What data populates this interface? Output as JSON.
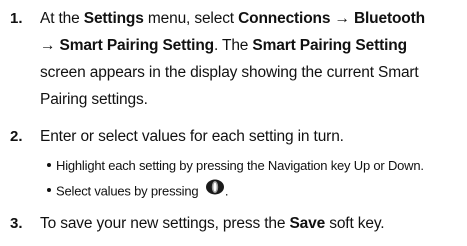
{
  "steps": [
    {
      "number": "1.",
      "parts": {
        "p1": "At the ",
        "b1": "Settings",
        "p2": " menu, select ",
        "b2": "Connections → Bluetooth",
        "b3": "→ Smart Pairing Setting",
        "p3": ". The ",
        "b4": "Smart Pairing Setting",
        "p4": "screen appears in the display showing the current Smart",
        "p5": "Pairing settings."
      }
    },
    {
      "number": "2.",
      "text": "Enter or select values for each setting in turn.",
      "bullets": [
        {
          "text": "Highlight each setting by pressing the Navigation key Up or Down."
        },
        {
          "text": "Select values by pressing",
          "icon": "navigation-center-key-icon",
          "after": "."
        }
      ]
    },
    {
      "number": "3.",
      "parts": {
        "p1": "To save your new settings, press the ",
        "b1": "Save",
        "p2": " soft key."
      }
    }
  ]
}
